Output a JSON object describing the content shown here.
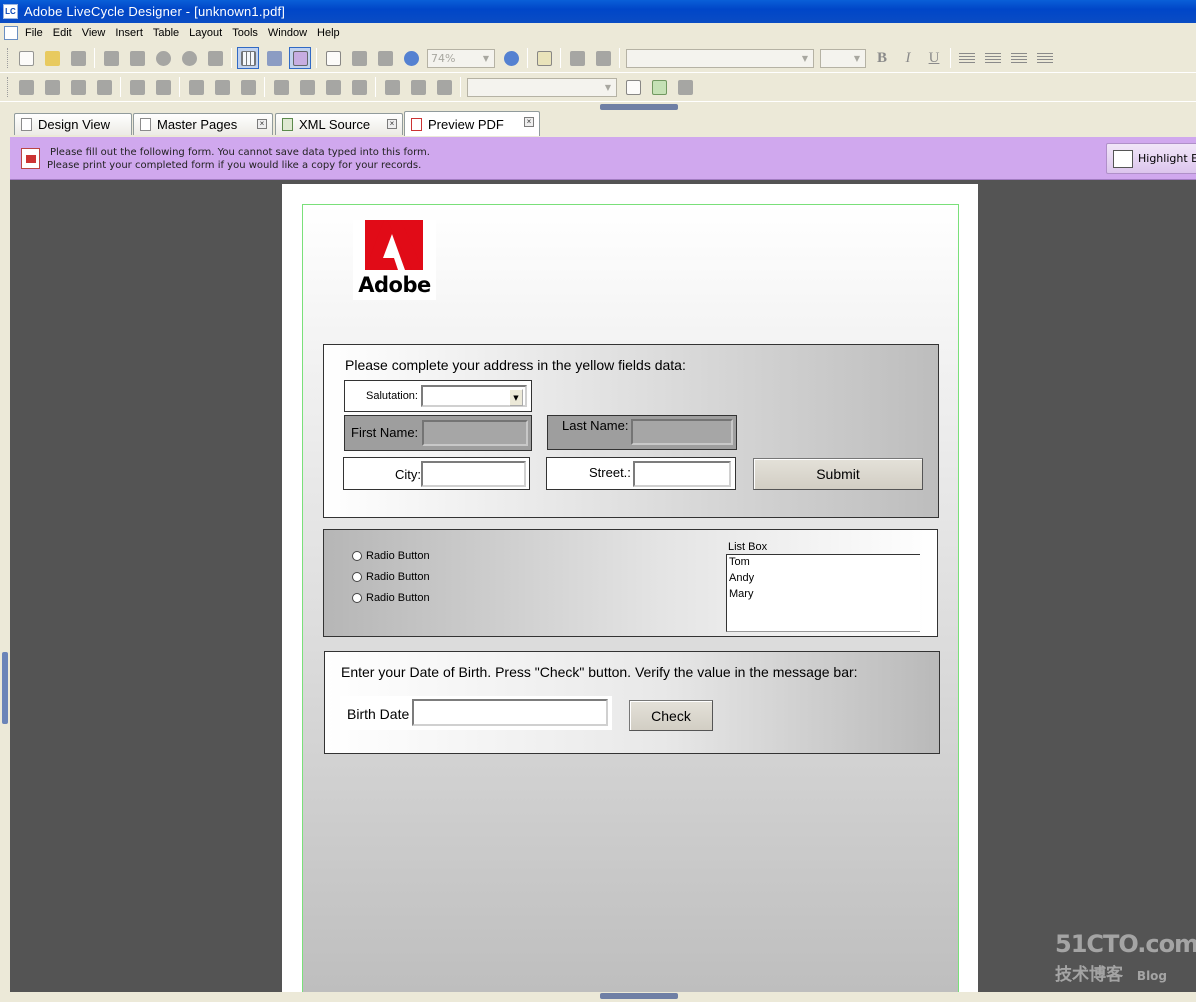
{
  "window": {
    "app_icon_text": "LC",
    "title": "Adobe LiveCycle Designer - [unknown1.pdf]"
  },
  "menu": [
    "File",
    "Edit",
    "View",
    "Insert",
    "Table",
    "Layout",
    "Tools",
    "Window",
    "Help"
  ],
  "toolbar": {
    "zoom_value": "74%"
  },
  "tabs": [
    {
      "label": "Design View",
      "icon": "page-icon",
      "closable": false,
      "active": false
    },
    {
      "label": "Master Pages",
      "icon": "page-icon",
      "closable": true,
      "active": false
    },
    {
      "label": "XML Source",
      "icon": "xml-icon",
      "closable": true,
      "active": false
    },
    {
      "label": "Preview PDF",
      "icon": "pdf-icon",
      "closable": true,
      "active": true
    }
  ],
  "infobar": {
    "line1": "Please fill out the following form. You cannot save data typed into this form.",
    "line2": "Please print your completed form if you would like a copy for your records.",
    "highlight_button": "Highlight Existing Fields",
    "background": "#d0a8ee"
  },
  "form": {
    "logo_word": "Adobe",
    "address": {
      "title": "Please complete your address  in the yellow fields data:",
      "salutation_label": "Salutation:",
      "first_name_label": "First Name:",
      "last_name_label": "Last Name:",
      "city_label": "City:",
      "street_label": "Street.:",
      "submit_label": "Submit"
    },
    "radios": [
      "Radio Button",
      "Radio Button",
      "Radio Button"
    ],
    "listbox": {
      "label": "List Box",
      "items": [
        "Tom",
        "Andy",
        "Mary"
      ]
    },
    "birth": {
      "title": "Enter your Date of Birth. Press \"Check\" button. Verify the value in the message bar:",
      "label": "Birth Date",
      "check_label": "Check"
    }
  },
  "watermark": {
    "line1": "51CTO.com",
    "line2": "技术博客",
    "line3": "Blog"
  }
}
